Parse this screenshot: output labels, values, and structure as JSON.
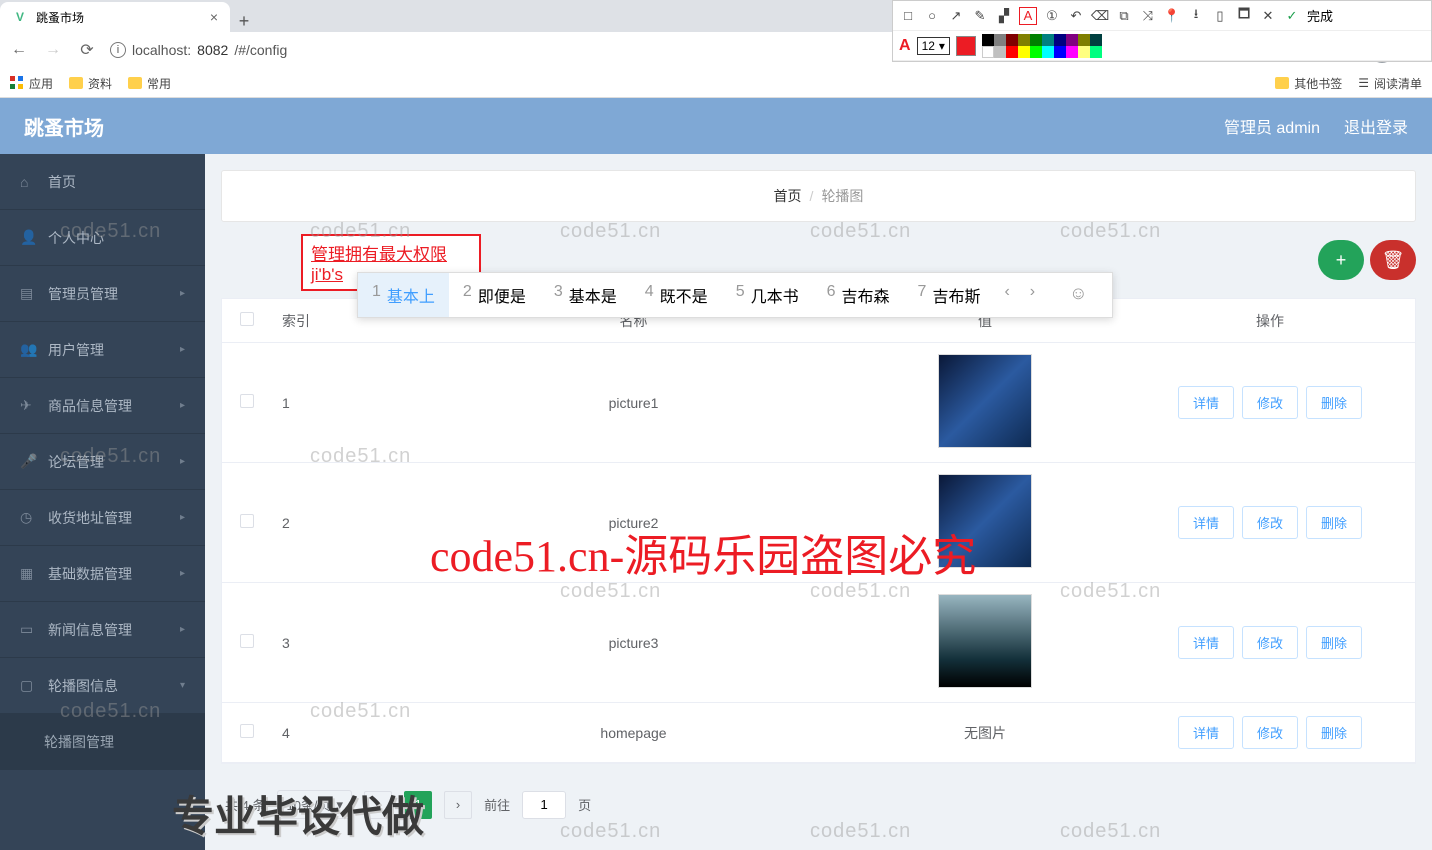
{
  "browser": {
    "tab_title": "跳蚤市场",
    "url_host": "localhost:",
    "url_port": "8082",
    "url_path": "/#/config",
    "bm_apps": "应用",
    "bm_1": "资料",
    "bm_2": "常用",
    "bm_other": "其他书签",
    "bm_reading": "阅读清单"
  },
  "devtools": {
    "done": "完成",
    "font_label": "A",
    "size": "12"
  },
  "app": {
    "brand": "跳蚤市场",
    "user_label": "管理员 admin",
    "logout": "退出登录"
  },
  "sidebar": {
    "items": [
      {
        "label": "首页",
        "expand": ""
      },
      {
        "label": "个人中心",
        "expand": ""
      },
      {
        "label": "管理员管理",
        "expand": "▸"
      },
      {
        "label": "用户管理",
        "expand": "▸"
      },
      {
        "label": "商品信息管理",
        "expand": "▸"
      },
      {
        "label": "论坛管理",
        "expand": "▸"
      },
      {
        "label": "收货地址管理",
        "expand": "▸"
      },
      {
        "label": "基础数据管理",
        "expand": "▸"
      },
      {
        "label": "新闻信息管理",
        "expand": "▸"
      },
      {
        "label": "轮播图信息",
        "expand": "▾"
      }
    ],
    "sub": "轮播图管理"
  },
  "breadcrumb": {
    "root": "首页",
    "sep": "/",
    "current": "轮播图"
  },
  "ime": {
    "input": "管理拥有最大权限ji'b's",
    "candidates": [
      "基本上",
      "即便是",
      "基本是",
      "既不是",
      "几本书",
      "吉布森",
      "吉布斯"
    ]
  },
  "table": {
    "headers": {
      "idx": "索引",
      "name": "名称",
      "val": "值",
      "ops": "操作"
    },
    "ops": {
      "detail": "详情",
      "edit": "修改",
      "del": "删除"
    },
    "no_img": "无图片",
    "rows": [
      {
        "idx": "1",
        "name": "picture1",
        "has_img": true
      },
      {
        "idx": "2",
        "name": "picture2",
        "has_img": true
      },
      {
        "idx": "3",
        "name": "picture3",
        "has_img": true
      },
      {
        "idx": "4",
        "name": "homepage",
        "has_img": false
      }
    ]
  },
  "pager": {
    "total": "共 4 条",
    "size": "10条/页",
    "cur": "1",
    "goto_pre": "前往",
    "goto_suf": "页",
    "page_input": "1"
  },
  "watermarks": {
    "wm": "code51.cn",
    "red": "code51.cn-源码乐园盗图必究",
    "bottom": "专业毕设代做"
  }
}
